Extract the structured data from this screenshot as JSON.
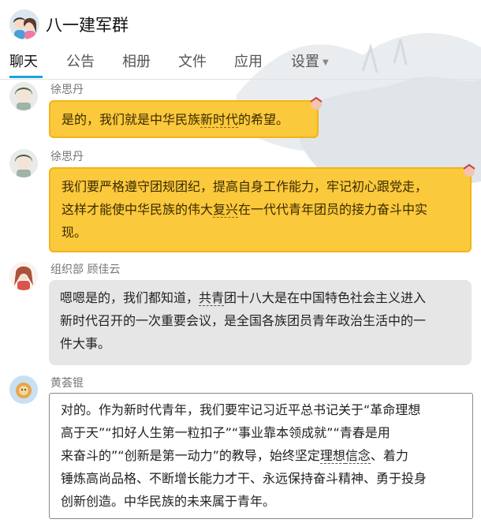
{
  "header": {
    "group_name": "八一建军群",
    "tabs": [
      {
        "label": "聊天",
        "active": true
      },
      {
        "label": "公告"
      },
      {
        "label": "相册"
      },
      {
        "label": "文件"
      },
      {
        "label": "应用"
      },
      {
        "label": "设置"
      }
    ]
  },
  "messages": [
    {
      "sender": "徐思丹",
      "style": "gold",
      "lines": [
        "是的，我们就是中华民族新时代的希望。"
      ]
    },
    {
      "sender": "徐思丹",
      "style": "gold",
      "lines": [
        "我们要严格遵守团规团纪，提高自身工作能力，牢记初心跟党走，",
        "这样才能使中华民族的伟大复兴在一代代青年团员的接力奋斗中实",
        "现。"
      ]
    },
    {
      "sender": "组织部 顾佳云",
      "style": "gray",
      "lines": [
        "嗯嗯是的，我们都知道，共青团十八大是在中国特色社会主义进入",
        "新时代召开的一次重要会议，是全国各族团员青年政治生活中的一",
        "件大事。"
      ]
    },
    {
      "sender": "黄荟锟",
      "style": "white",
      "lines": [
        "对的。作为新时代青年，我们要牢记习近平总书记关于“革命理想",
        "高于天”“扣好人生第一粒扣子”“事业靠本领成就”“青春是用",
        "来奋斗的”“创新是第一动力”的教导，始终坚定理想信念、着力",
        "锤炼高尚品格、不断增长能力才干、永远保持奋斗精神、勇于投身",
        "创新创造。中华民族的未来属于青年。"
      ]
    }
  ],
  "colors": {
    "accent": "#1aa3e0",
    "gold_bubble": "#fbc93c",
    "gray_bubble": "#e6e6e6"
  }
}
